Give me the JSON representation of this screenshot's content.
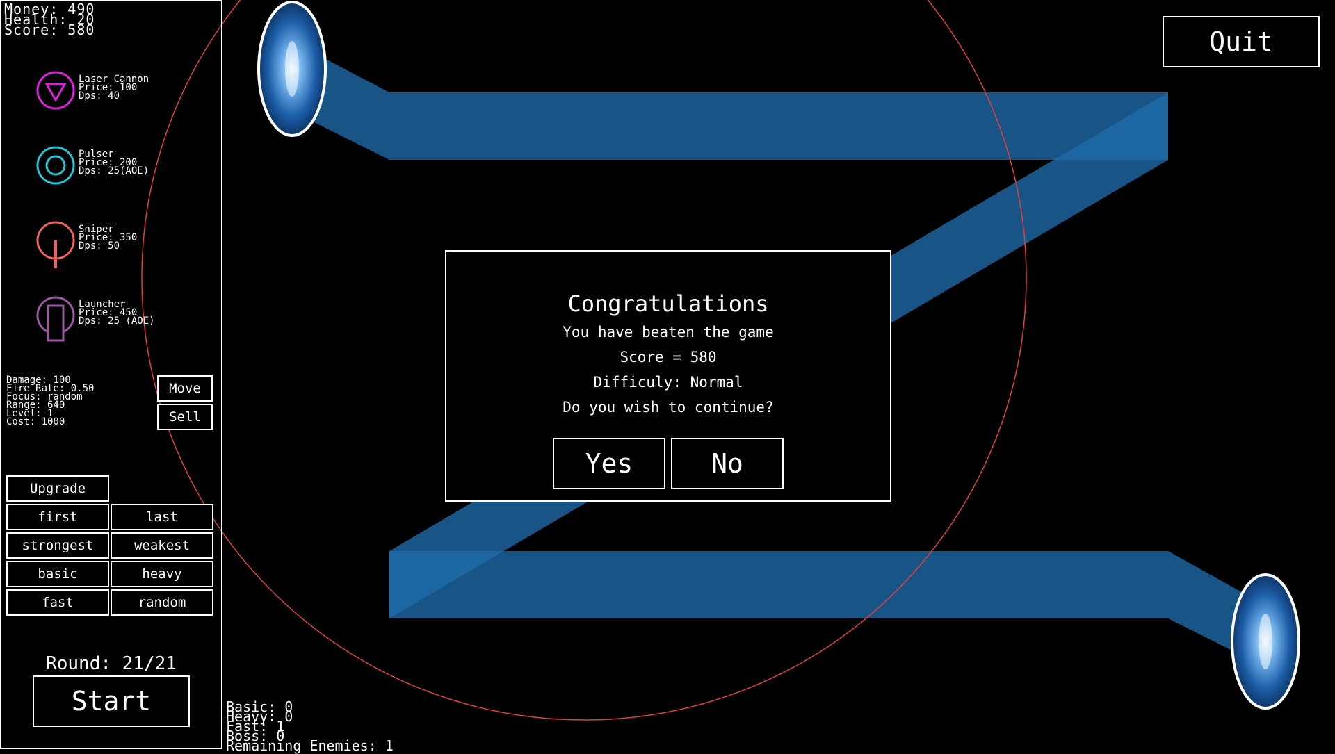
{
  "hud": {
    "money": "Money: 490",
    "health": "Health: 20",
    "score": "Score: 580"
  },
  "shop": {
    "towers": [
      {
        "name": "Laser Cannon",
        "price": "Price: 100",
        "dps": "Dps: 40",
        "color": "#e020e0",
        "icon": "triangle-in-circle-icon"
      },
      {
        "name": "Pulser",
        "price": "Price: 200",
        "dps": "Dps: 25(AOE)",
        "color": "#20c8d8",
        "icon": "concentric-circles-icon"
      },
      {
        "name": "Sniper",
        "price": "Price: 350",
        "dps": "Dps: 50",
        "color": "#f06060",
        "icon": "sniper-scope-icon"
      },
      {
        "name": "Launcher",
        "price": "Price: 450",
        "dps": "Dps: 25 (AOE)",
        "color": "#9a5aa0",
        "icon": "launcher-tube-icon"
      }
    ]
  },
  "selected_tower": {
    "damage": "Damage: 100",
    "fire_rate": "Fire Rate: 0.50",
    "focus": "Focus: random",
    "range": "Range: 640",
    "level": "Level: 1",
    "cost": "Cost: 1000",
    "move_label": "Move",
    "sell_label": "Sell",
    "upgrade_label": "Upgrade"
  },
  "targeting": [
    "first",
    "last",
    "strongest",
    "weakest",
    "basic",
    "heavy",
    "fast",
    "random"
  ],
  "round": {
    "label": "Round: 21/21",
    "start_label": "Start"
  },
  "quit_label": "Quit",
  "enemies": {
    "basic": "Basic: 0",
    "heavy": "Heavy: 0",
    "fast": "Fast: 1",
    "boss": "Boss: 0",
    "remaining": "Remaining Enemies: 1"
  },
  "dialog": {
    "title": "Congratulations",
    "line1": "You have beaten the game",
    "line2": "Score = 580",
    "line3": "Difficuly: Normal",
    "line4": "Do you wish to continue?",
    "yes_label": "Yes",
    "no_label": "No"
  },
  "colors": {
    "path": "#1e6aa8",
    "range_circle": "#e04040",
    "portal": "#3a8ee0"
  }
}
